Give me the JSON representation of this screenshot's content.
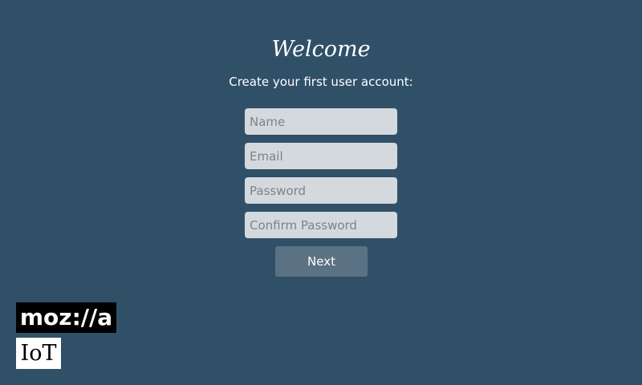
{
  "header": {
    "title": "Welcome",
    "subtitle": "Create your first user account:"
  },
  "form": {
    "name_placeholder": "Name",
    "email_placeholder": "Email",
    "password_placeholder": "Password",
    "confirm_password_placeholder": "Confirm Password",
    "next_label": "Next"
  },
  "logos": {
    "mozilla": "moz://a",
    "iot": "IoT"
  },
  "colors": {
    "background": "#305068",
    "input_background": "#d4d9de",
    "button_background": "#5b7184"
  }
}
